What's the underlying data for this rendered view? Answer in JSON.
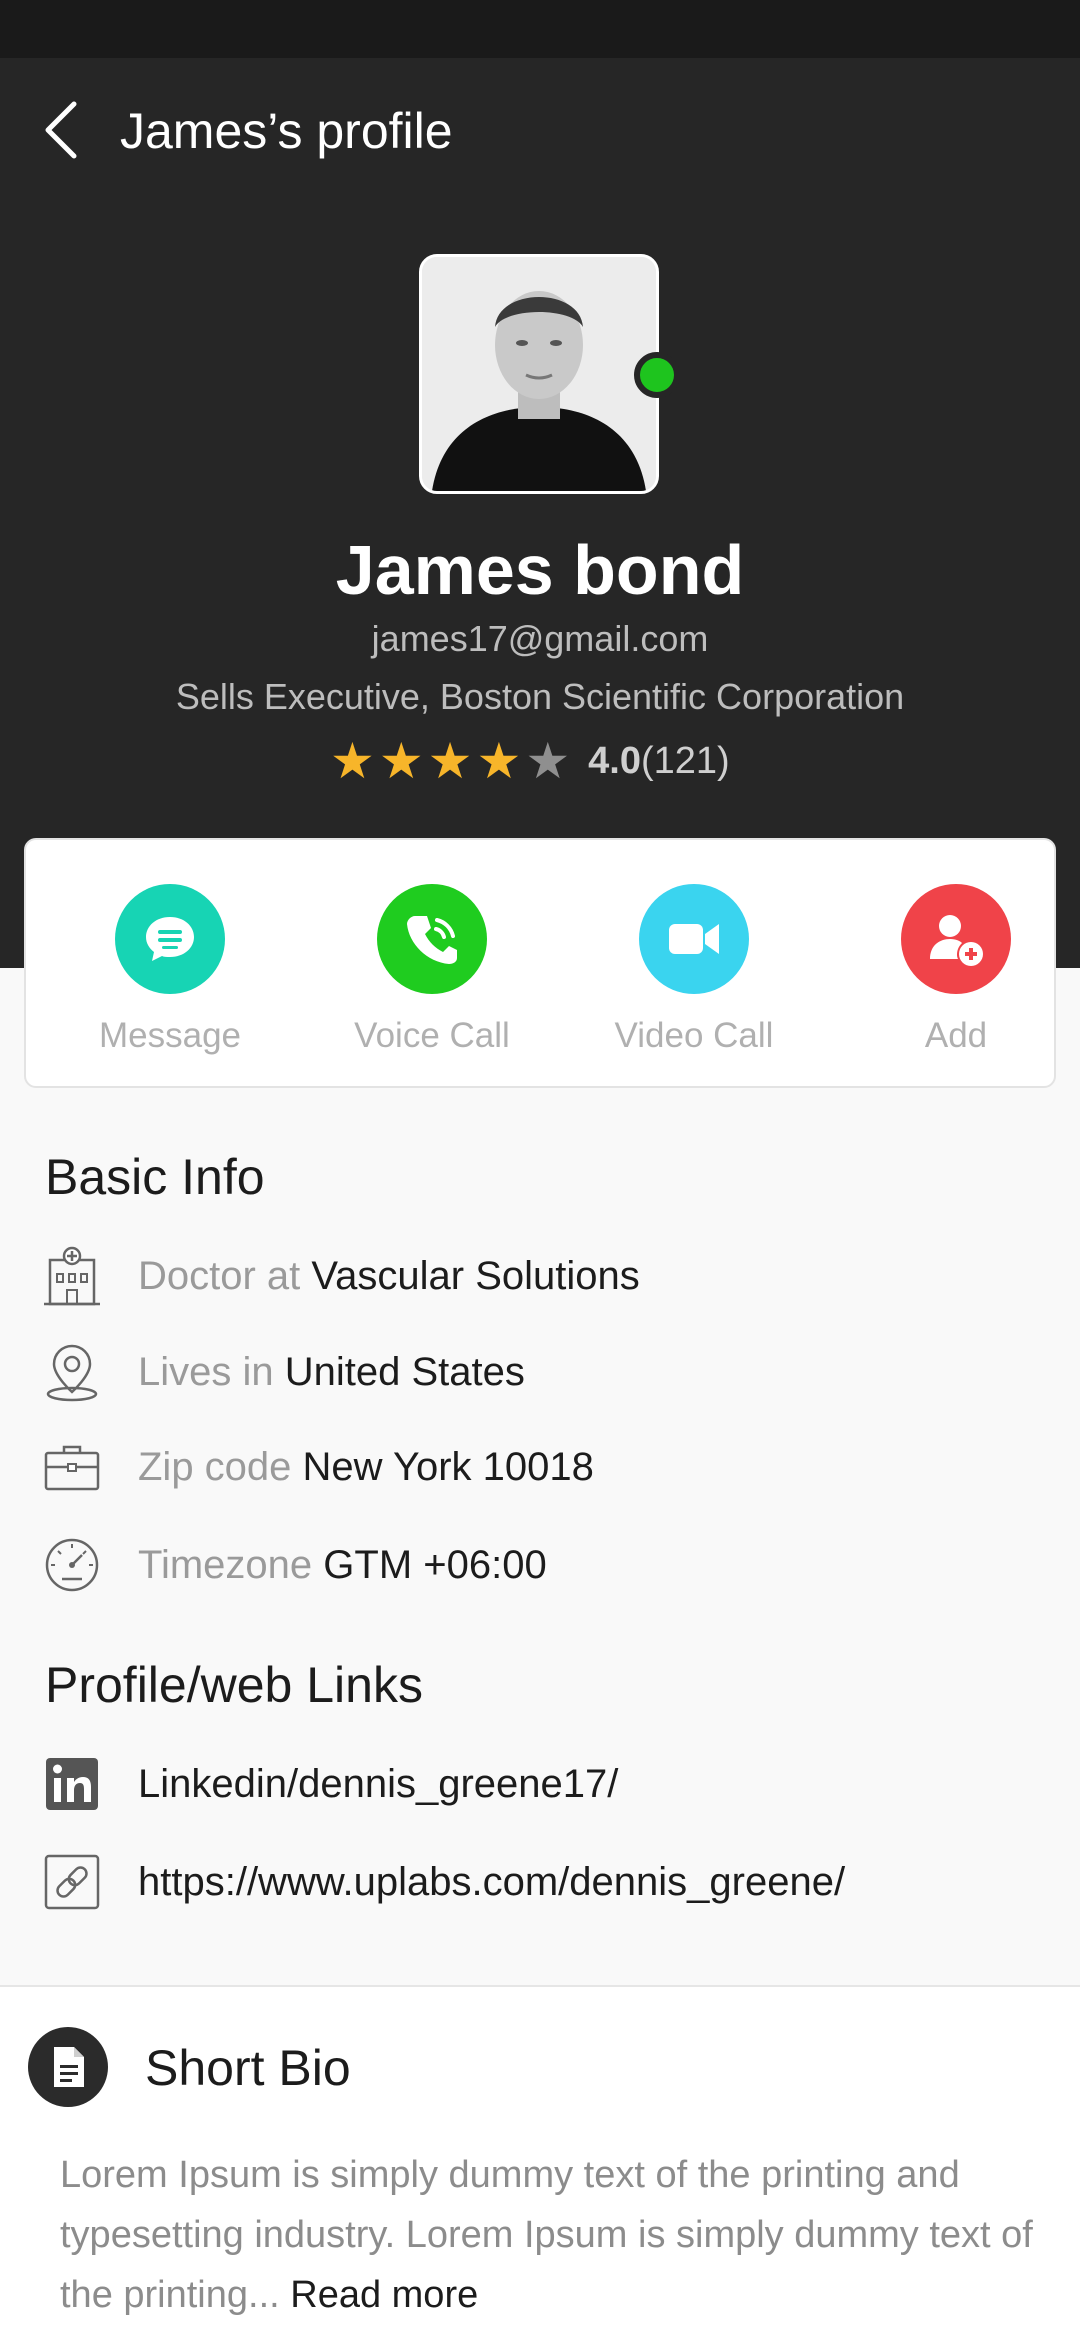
{
  "header": {
    "title": "James’s profile",
    "back_icon": "chevron-left-icon"
  },
  "profile": {
    "name": "James bond",
    "email": "james17@gmail.com",
    "job": "Sells Executive, Boston Scientific Corporation",
    "online": true,
    "online_color": "#1ec41e",
    "rating": {
      "stars_filled": 4,
      "stars_total": 5,
      "value": "4.0",
      "count": "(121)",
      "star_color": "#f7b52a"
    }
  },
  "actions": [
    {
      "label": "Message",
      "icon": "chat-bubble-icon",
      "color": "#17d4b4"
    },
    {
      "label": "Voice Call",
      "icon": "phone-icon",
      "color": "#1fcc1f"
    },
    {
      "label": "Video Call",
      "icon": "video-camera-icon",
      "color": "#3ad4ef"
    },
    {
      "label": "Add",
      "icon": "add-user-icon",
      "color": "#f04349"
    }
  ],
  "basic_info": {
    "title": "Basic Info",
    "items": [
      {
        "icon": "hospital-icon",
        "prefix": "Doctor at",
        "value": "Vascular Solutions"
      },
      {
        "icon": "location-pin-icon",
        "prefix": "Lives in",
        "value": "United States"
      },
      {
        "icon": "briefcase-icon",
        "prefix": "Zip code",
        "value": "New York 10018"
      },
      {
        "icon": "clock-icon",
        "prefix": "Timezone",
        "value": "GTM +06:00"
      }
    ]
  },
  "links": {
    "title": "Profile/web Links",
    "items": [
      {
        "icon": "linkedin-icon",
        "text": "Linkedin/dennis_greene17/"
      },
      {
        "icon": "link-icon",
        "text": "https://www.uplabs.com/dennis_greene/"
      }
    ]
  },
  "bio": {
    "title": "Short Bio",
    "icon": "document-icon",
    "text": "Lorem Ipsum is simply dummy text of the printing and typesetting industry. Lorem Ipsum is simply dummy text of the printing...",
    "read_more": "Read more"
  }
}
